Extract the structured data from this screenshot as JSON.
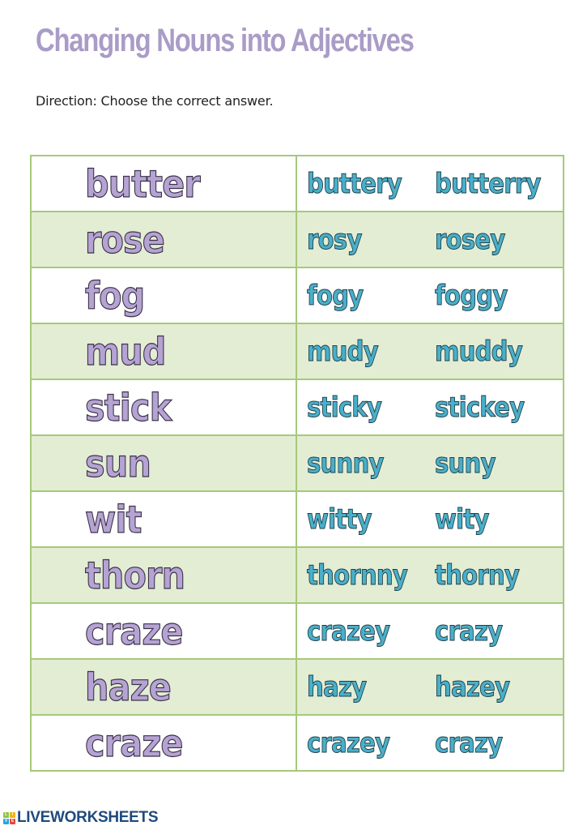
{
  "title": "Changing Nouns into Adjectives",
  "direction": "Direction:  Choose the correct answer.",
  "rows": [
    {
      "noun": "butter",
      "options": [
        "buttery",
        "butterry"
      ]
    },
    {
      "noun": "rose",
      "options": [
        "rosy",
        "rosey"
      ]
    },
    {
      "noun": "fog",
      "options": [
        "fogy",
        "foggy"
      ]
    },
    {
      "noun": "mud",
      "options": [
        "mudy",
        "muddy"
      ]
    },
    {
      "noun": "stick",
      "options": [
        "sticky",
        "stickey"
      ]
    },
    {
      "noun": "sun",
      "options": [
        "sunny",
        "suny"
      ]
    },
    {
      "noun": "wit",
      "options": [
        "witty",
        "wity"
      ]
    },
    {
      "noun": "thorn",
      "options": [
        "thornny",
        "thorny"
      ]
    },
    {
      "noun": "craze",
      "options": [
        "crazey",
        "crazy"
      ]
    },
    {
      "noun": "haze",
      "options": [
        "hazy",
        "hazey"
      ]
    },
    {
      "noun": "craze",
      "options": [
        "crazey",
        "crazy"
      ]
    }
  ],
  "footer": {
    "brand": "LIVEWORKSHEETS",
    "logo_letters": [
      "L",
      "I",
      "V",
      "E"
    ],
    "logo_colors": [
      "#8bc34a",
      "#f4b400",
      "#29a3dd",
      "#e8453c"
    ]
  },
  "colors": {
    "title": "#a99cc6",
    "noun_fill": "#b5a3d3",
    "option_fill": "#4aafc9",
    "row_alt": "#e3edd3",
    "border": "#a6c97a",
    "brand": "#1f4a7e"
  }
}
